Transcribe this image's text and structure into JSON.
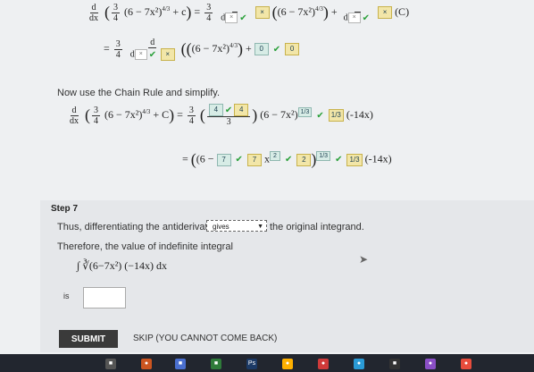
{
  "math": {
    "line1": {
      "lead": "d",
      "leadDen": "dx",
      "inner": "(6 − 7x²)",
      "pow": "4/3",
      "tail": "+ c",
      "eq": "=",
      "coef": "3",
      "coefDen": "4",
      "fracNumBlank": "",
      "fracDenPrefix": "d",
      "result": "(C)"
    },
    "line2": {
      "coef": "3",
      "coefDen": "4",
      "fracNum": "d",
      "fracDenPrefix": "d",
      "inner": "(6 − 7x²)",
      "pow": "4/3",
      "plus": "+",
      "box1": "0",
      "box2": "0"
    },
    "chain_text": "Now use the Chain Rule and simplify.",
    "line3": {
      "coef": "3",
      "coefDen": "4",
      "box_a": "4",
      "box_b": "4",
      "den": "3",
      "inner": "(6 − 7x²)",
      "pow": "1/3",
      "box_c": "1/3",
      "tail": "(-14x)"
    },
    "line4": {
      "eq": "=",
      "inner": "(6 −",
      "box1": "7",
      "box2": "7",
      "xpart": "x",
      "box3": "2",
      "pow": "1/3",
      "box4": "1/3",
      "tail": "(-14x)"
    }
  },
  "step": {
    "title": "Step 7",
    "sentence_before": "Thus, differentiating the antiderivative",
    "dropdown_value": "gives",
    "sentence_after": "the original integrand.",
    "therefore": "Therefore, the value of indefinite integral",
    "integral": "∫ ∛(6−7x²) (−14x) dx",
    "is_label": "is"
  },
  "buttons": {
    "submit": "SUBMIT",
    "skip": "SKIP (YOU CANNOT COME BACK)"
  },
  "taskbar": {
    "ps_label": "Ps"
  }
}
